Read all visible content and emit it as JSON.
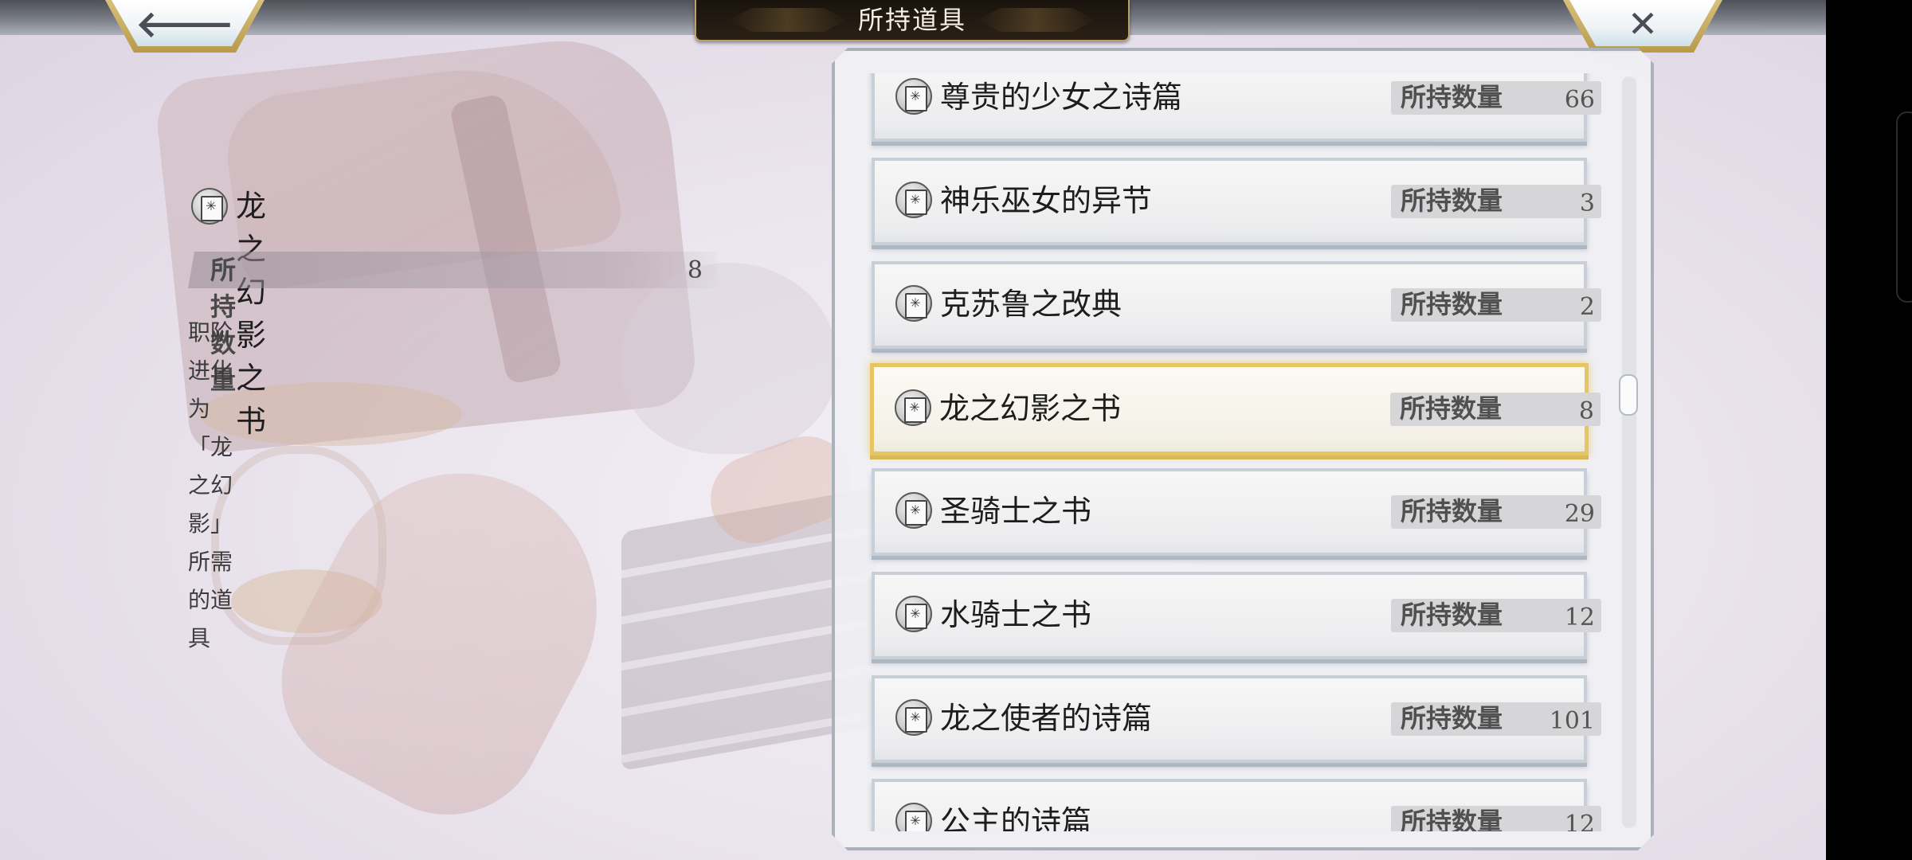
{
  "header": {
    "title": "所持道具",
    "back_glyph": "🡐",
    "close_glyph": "✕"
  },
  "detail": {
    "name": "龙之幻影之书",
    "qty_label": "所持数量",
    "qty_value": "8",
    "description": "职阶进化为「龙之幻影」所需的道具"
  },
  "items": [
    {
      "name": "尊贵的少女之诗篇",
      "qty_label": "所持数量",
      "qty": "66",
      "selected": false
    },
    {
      "name": "神乐巫女的异节",
      "qty_label": "所持数量",
      "qty": "3",
      "selected": false
    },
    {
      "name": "克苏鲁之改典",
      "qty_label": "所持数量",
      "qty": "2",
      "selected": false
    },
    {
      "name": "龙之幻影之书",
      "qty_label": "所持数量",
      "qty": "8",
      "selected": true
    },
    {
      "name": "圣骑士之书",
      "qty_label": "所持数量",
      "qty": "29",
      "selected": false
    },
    {
      "name": "水骑士之书",
      "qty_label": "所持数量",
      "qty": "12",
      "selected": false
    },
    {
      "name": "龙之使者的诗篇",
      "qty_label": "所持数量",
      "qty": "101",
      "selected": false
    },
    {
      "name": "公主的诗篇",
      "qty_label": "所持数量",
      "qty": "12",
      "selected": false
    }
  ],
  "colors": {
    "selected_border": "#e6c564",
    "title_plate": "#1a140e",
    "corner_gold": "#c8ad63"
  },
  "icons": {
    "item": "book-emblem-icon",
    "back": "back-arrow-icon",
    "close": "close-icon"
  }
}
